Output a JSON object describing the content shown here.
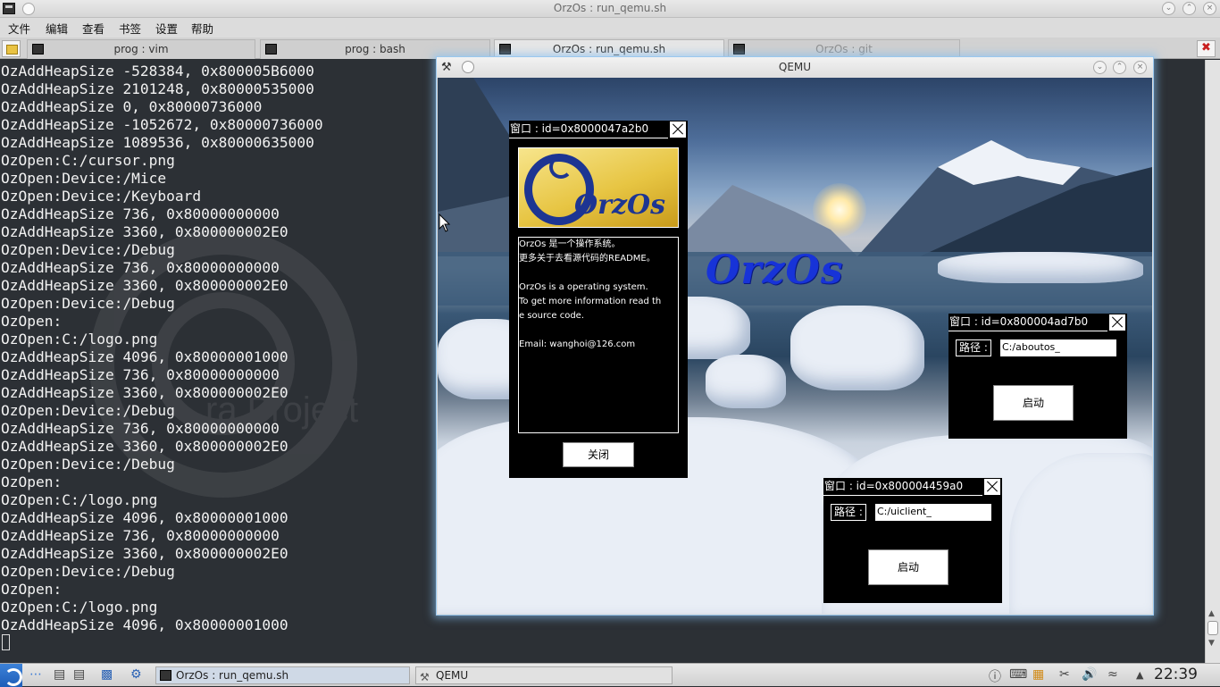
{
  "window": {
    "title": "OrzOs : run_qemu.sh"
  },
  "menu": [
    "文件",
    "编辑",
    "查看",
    "书签",
    "设置",
    "帮助"
  ],
  "tabs": [
    {
      "label": "prog : vim",
      "active": false
    },
    {
      "label": "prog : bash",
      "active": false
    },
    {
      "label": "OrzOs : run_qemu.sh",
      "active": true
    },
    {
      "label": "OrzOs : git",
      "active": false
    }
  ],
  "terminal": {
    "lines": [
      "OzAddHeapSize -528384, 0x800005B6000",
      "OzAddHeapSize 2101248, 0x80000535000",
      "OzAddHeapSize 0, 0x80000736000",
      "OzAddHeapSize -1052672, 0x80000736000",
      "OzAddHeapSize 1089536, 0x80000635000",
      "OzOpen:C:/cursor.png",
      "OzOpen:Device:/Mice",
      "OzOpen:Device:/Keyboard",
      "OzAddHeapSize 736, 0x80000000000",
      "OzAddHeapSize 3360, 0x800000002E0",
      "OzOpen:Device:/Debug",
      "OzAddHeapSize 736, 0x80000000000",
      "OzAddHeapSize 3360, 0x800000002E0",
      "OzOpen:Device:/Debug",
      "OzOpen:",
      "OzOpen:C:/logo.png",
      "OzAddHeapSize 4096, 0x80000001000",
      "OzAddHeapSize 736, 0x80000000000",
      "OzAddHeapSize 3360, 0x800000002E0",
      "OzOpen:Device:/Debug",
      "OzAddHeapSize 736, 0x80000000000",
      "OzAddHeapSize 3360, 0x800000002E0",
      "OzOpen:Device:/Debug",
      "OzOpen:",
      "OzOpen:C:/logo.png",
      "OzAddHeapSize 4096, 0x80000001000",
      "OzAddHeapSize 736, 0x80000000000",
      "OzAddHeapSize 3360, 0x800000002E0",
      "OzOpen:Device:/Debug",
      "OzOpen:",
      "OzOpen:C:/logo.png",
      "OzAddHeapSize 4096, 0x80000001000"
    ],
    "watermark": "ra Project"
  },
  "qemu": {
    "title": "QEMU",
    "desktop_logo": "OrzOs",
    "about_window": {
      "title": "窗口 : id=0x8000047a2b0",
      "logo_text": "OrzOs",
      "text": "OrzOs 是一个操作系统。\n更多关于去看源代码的README。\n\nOrzOs is a operating system.\nTo get more information read th\ne source code.\n\nEmail: wanghoi@126.com",
      "close_button": "关闭"
    },
    "launcher1": {
      "title": "窗口 : id=0x800004ad7b0",
      "path_label": "路径 :",
      "path_value": "C:/aboutos_",
      "start_button": "启动"
    },
    "launcher2": {
      "title": "窗口 : id=0x800004459a0",
      "path_label": "路径 :",
      "path_value": "C:/uiclient_",
      "start_button": "启动"
    }
  },
  "taskbar": {
    "tasks": [
      {
        "label": "OrzOs : run_qemu.sh",
        "active": true
      },
      {
        "label": "QEMU",
        "active": false
      }
    ],
    "clock": "22:39"
  }
}
